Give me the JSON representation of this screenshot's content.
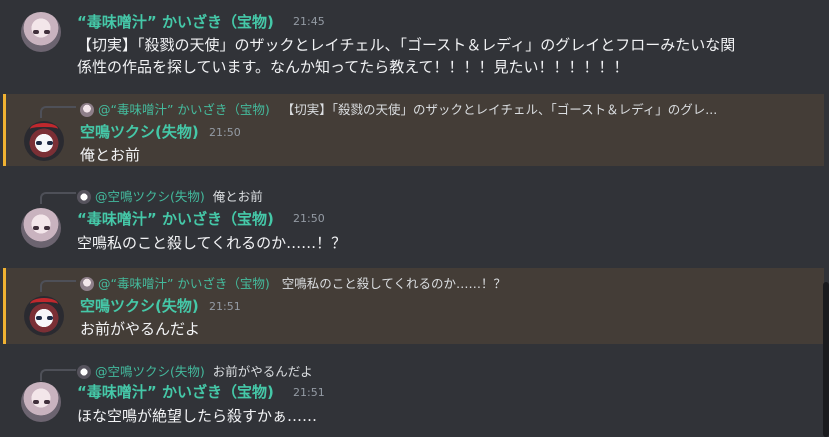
{
  "messages": [
    {
      "author": "“毒味噌汁” かいざき（宝物)",
      "time": "21:45",
      "lines": [
        "【切実】「殺戮の天使」のザックとレイチェル、「ゴースト＆レディ」のグレイとフローみたいな関",
        "係性の作品を探しています。なんか知ってたら教えて！！！！見たい！！！！！！"
      ]
    },
    {
      "reply_to": "@“毒味噌汁” かいざき（宝物)",
      "reply_text": "【切実】「殺戮の天使」のザックとレイチェル、「ゴースト＆レディ」のグレ...",
      "author": "空鳴ツクシ(失物)",
      "time": "21:50",
      "text": "俺とお前"
    },
    {
      "reply_to": "@空鳴ツクシ(失物)",
      "reply_text": "俺とお前",
      "author": "“毒味噌汁” かいざき（宝物)",
      "time": "21:50",
      "text": "空鳴私のこと殺してくれるのか……！？"
    },
    {
      "reply_to": "@“毒味噌汁” かいざき（宝物)",
      "reply_text": "空鳴私のこと殺してくれるのか……！？",
      "author": "空鳴ツクシ(失物)",
      "time": "21:51",
      "text": "お前がやるんだよ"
    },
    {
      "reply_to": "@空鳴ツクシ(失物)",
      "reply_text": "お前がやるんだよ",
      "author": "“毒味噌汁” かいざき（宝物)",
      "time": "21:51",
      "text": "ほな空鳴が絶望したら殺すかぁ……"
    }
  ]
}
